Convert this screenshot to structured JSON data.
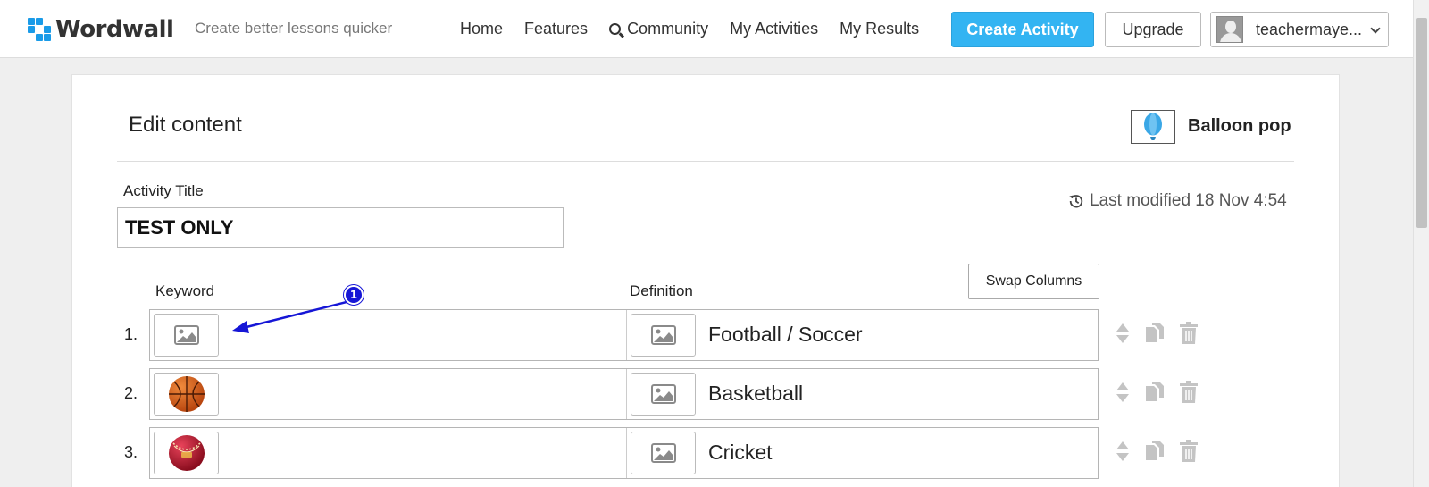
{
  "brand": {
    "name": "Wordwall",
    "tagline": "Create better lessons quicker"
  },
  "nav": {
    "items": [
      "Home",
      "Features",
      "Community",
      "My Activities",
      "My Results"
    ],
    "create_label": "Create Activity",
    "upgrade_label": "Upgrade",
    "user_name": "teachermaye..."
  },
  "editor": {
    "heading": "Edit content",
    "template_name": "Balloon pop",
    "title_label": "Activity Title",
    "title_value": "TEST ONLY",
    "last_modified": "Last modified 18 Nov 4:54",
    "swap_label": "Swap Columns",
    "keyword_header": "Keyword",
    "definition_header": "Definition",
    "rows": [
      {
        "number": "1.",
        "keyword_image": "placeholder-image-icon",
        "definition": "Football / Soccer"
      },
      {
        "number": "2.",
        "keyword_image": "basketball",
        "definition": "Basketball"
      },
      {
        "number": "3.",
        "keyword_image": "cricket-ball",
        "definition": "Cricket"
      }
    ]
  },
  "annotation": {
    "step": "1",
    "color": "#1616d6"
  },
  "colors": {
    "accent": "#33b4f2",
    "logo_blue": "#1a9be8"
  }
}
